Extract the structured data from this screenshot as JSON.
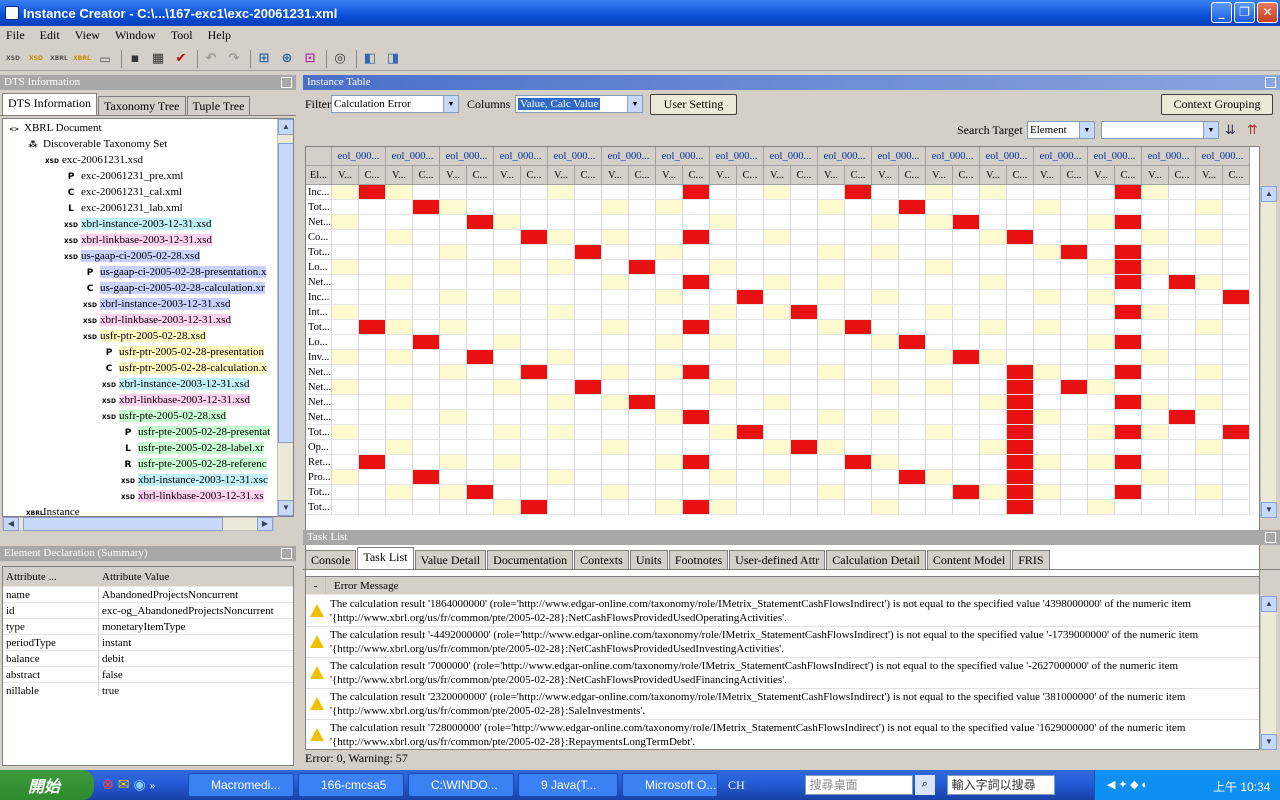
{
  "window": {
    "title": "Instance Creator - C:\\...\\167-exc1\\exc-20061231.xml"
  },
  "menu": [
    "File",
    "Edit",
    "View",
    "Window",
    "Tool",
    "Help"
  ],
  "toolbar": {
    "icons": [
      "xsd-icon",
      "xsd-new-icon",
      "xbrl-icon",
      "xbrl-new-icon",
      "window-icon",
      "save-icon",
      "save-all-icon",
      "check-icon",
      "undo-icon",
      "redo-icon",
      "add-icon",
      "add-child-icon",
      "add-attr-icon",
      "view-icon",
      "panel-left-icon",
      "panel-right-icon"
    ]
  },
  "dts": {
    "title": "DTS Information",
    "tabs": [
      "DTS Information",
      "Taxonomy Tree",
      "Tuple Tree"
    ],
    "nodes": [
      {
        "label": "XBRL Document",
        "ic": "<>",
        "lvl": 0,
        "hl": ""
      },
      {
        "label": "Discoverable Taxonomy Set",
        "ic": "⁂",
        "lvl": 1,
        "hl": ""
      },
      {
        "label": "exc-20061231.xsd",
        "ic": "XSD",
        "lvl": 2,
        "hl": ""
      },
      {
        "label": "exc-20061231_pre.xml",
        "ic": "P",
        "lvl": 3,
        "hl": ""
      },
      {
        "label": "exc-20061231_cal.xml",
        "ic": "C",
        "lvl": 3,
        "hl": ""
      },
      {
        "label": "exc-20061231_lab.xml",
        "ic": "L",
        "lvl": 3,
        "hl": ""
      },
      {
        "label": "xbrl-instance-2003-12-31.xsd",
        "ic": "XSD",
        "lvl": 3,
        "hl": "cyan"
      },
      {
        "label": "xbrl-linkbase-2003-12-31.xsd",
        "ic": "XSD",
        "lvl": 3,
        "hl": "pink"
      },
      {
        "label": "us-gaap-ci-2005-02-28.xsd",
        "ic": "XSD",
        "lvl": 3,
        "hl": "blue"
      },
      {
        "label": "us-gaap-ci-2005-02-28-presentation.x",
        "ic": "P",
        "lvl": 4,
        "hl": "blue"
      },
      {
        "label": "us-gaap-ci-2005-02-28-calculation.xr",
        "ic": "C",
        "lvl": 4,
        "hl": "blue"
      },
      {
        "label": "xbrl-instance-2003-12-31.xsd",
        "ic": "XSD",
        "lvl": 4,
        "hl": "blue"
      },
      {
        "label": "xbrl-linkbase-2003-12-31.xsd",
        "ic": "XSD",
        "lvl": 4,
        "hl": "pink"
      },
      {
        "label": "usfr-ptr-2005-02-28.xsd",
        "ic": "XSD",
        "lvl": 4,
        "hl": "yellow"
      },
      {
        "label": "usfr-ptr-2005-02-28-presentation",
        "ic": "P",
        "lvl": 5,
        "hl": "yellow"
      },
      {
        "label": "usfr-ptr-2005-02-28-calculation.x",
        "ic": "C",
        "lvl": 5,
        "hl": "yellow"
      },
      {
        "label": "xbrl-instance-2003-12-31.xsd",
        "ic": "XSD",
        "lvl": 5,
        "hl": "cyan"
      },
      {
        "label": "xbrl-linkbase-2003-12-31.xsd",
        "ic": "XSD",
        "lvl": 5,
        "hl": "pink"
      },
      {
        "label": "usfr-pte-2005-02-28.xsd",
        "ic": "XSD",
        "lvl": 5,
        "hl": "green"
      },
      {
        "label": "usfr-pte-2005-02-28-presentat",
        "ic": "P",
        "lvl": 6,
        "hl": "green"
      },
      {
        "label": "usfr-pte-2005-02-28-label.xr",
        "ic": "L",
        "lvl": 6,
        "hl": "green"
      },
      {
        "label": "usfr-pte-2005-02-28-referenc",
        "ic": "R",
        "lvl": 6,
        "hl": "green"
      },
      {
        "label": "xbrl-instance-2003-12-31.xsc",
        "ic": "XSD",
        "lvl": 6,
        "hl": "cyan"
      },
      {
        "label": "xbrl-linkbase-2003-12-31.xs",
        "ic": "XSD",
        "lvl": 6,
        "hl": "pink"
      },
      {
        "label": "Instance",
        "ic": "XBRL",
        "lvl": 1,
        "hl": ""
      }
    ]
  },
  "elemdecl": {
    "title": "Element Declaration (Summary)",
    "col1": "Attribute ...",
    "col2": "Attribute Value",
    "rows": [
      [
        "name",
        "AbandonedProjectsNoncurrent"
      ],
      [
        "id",
        "exc-og_AbandonedProjectsNoncurrent"
      ],
      [
        "type",
        "monetaryItemType"
      ],
      [
        "periodType",
        "instant"
      ],
      [
        "balance",
        "debit"
      ],
      [
        "abstract",
        "false"
      ],
      [
        "nillable",
        "true"
      ]
    ]
  },
  "instance": {
    "title": "Instance Table",
    "filter_label": "Filter",
    "filter_value": "Calculation Error",
    "columns_label": "Columns",
    "columns_value": "Value, Calc Value",
    "user_setting": "User Setting",
    "context_grouping": "Context Grouping",
    "search_target_label": "Search Target",
    "search_target_value": "Element",
    "ctx_header": "eol_000...",
    "el_header": "El...",
    "v_header": "V...",
    "c_header": "C...",
    "row_labels": [
      "Inc...",
      "Tot...",
      "Net...",
      "Co...",
      "Tot...",
      "Lo...",
      "Net...",
      "Inc...",
      "Int...",
      "Tot...",
      "Lo...",
      "Inv...",
      "Net...",
      "Net...",
      "Net...",
      "Net...",
      "Tot...",
      "Op...",
      "Ret...",
      "Pro...",
      "Tot...",
      "Tot..."
    ]
  },
  "tasklist": {
    "title": "Task List",
    "tabs": [
      "Console",
      "Task List",
      "Value Detail",
      "Documentation",
      "Contexts",
      "Units",
      "Footnotes",
      "User-defined Attr",
      "Calculation Detail",
      "Content Model",
      "FRIS"
    ],
    "col_dash": "-",
    "col_msg": "Error Message",
    "errors": [
      "The calculation result '1864000000' (role='http://www.edgar-online.com/taxonomy/role/IMetrix_StatementCashFlowsIndirect') is not equal to the specified value '4398000000' of the numeric item '{http://www.xbrl.org/us/fr/common/pte/2005-02-28}:NetCashFlowsProvidedUsedOperatingActivities'.",
      "The calculation result '-4492000000' (role='http://www.edgar-online.com/taxonomy/role/IMetrix_StatementCashFlowsIndirect') is not equal to the specified value '-1739000000' of the numeric item '{http://www.xbrl.org/us/fr/common/pte/2005-02-28}:NetCashFlowsProvidedUsedInvestingActivities'.",
      "The calculation result '7000000' (role='http://www.edgar-online.com/taxonomy/role/IMetrix_StatementCashFlowsIndirect') is not equal to the specified value '-2627000000' of the numeric item '{http://www.xbrl.org/us/fr/common/pte/2005-02-28}:NetCashFlowsProvidedUsedFinancingActivities'.",
      "The calculation result '2320000000' (role='http://www.edgar-online.com/taxonomy/role/IMetrix_StatementCashFlowsIndirect') is not equal to the specified value '381000000' of the numeric item '{http://www.xbrl.org/us/fr/common/pte/2005-02-28}:SaleInvestments'.",
      "The calculation result '728000000' (role='http://www.edgar-online.com/taxonomy/role/IMetrix_StatementCashFlowsIndirect') is not equal to the specified value '1629000000' of the numeric item '{http://www.xbrl.org/us/fr/common/pte/2005-02-28}:RepaymentsLongTermDebt'."
    ],
    "status": "Error: 0, Warning: 57"
  },
  "taskbar": {
    "start": "開始",
    "tasks": [
      "Macromedi...",
      "166-cmcsa5",
      "C:\\WINDO...",
      "9 Java(T...",
      "Microsoft O..."
    ],
    "lang": "CH",
    "search_desktop": "搜尋桌面",
    "ime": "輸入字詞以搜尋",
    "clock": "上午 10:34"
  }
}
